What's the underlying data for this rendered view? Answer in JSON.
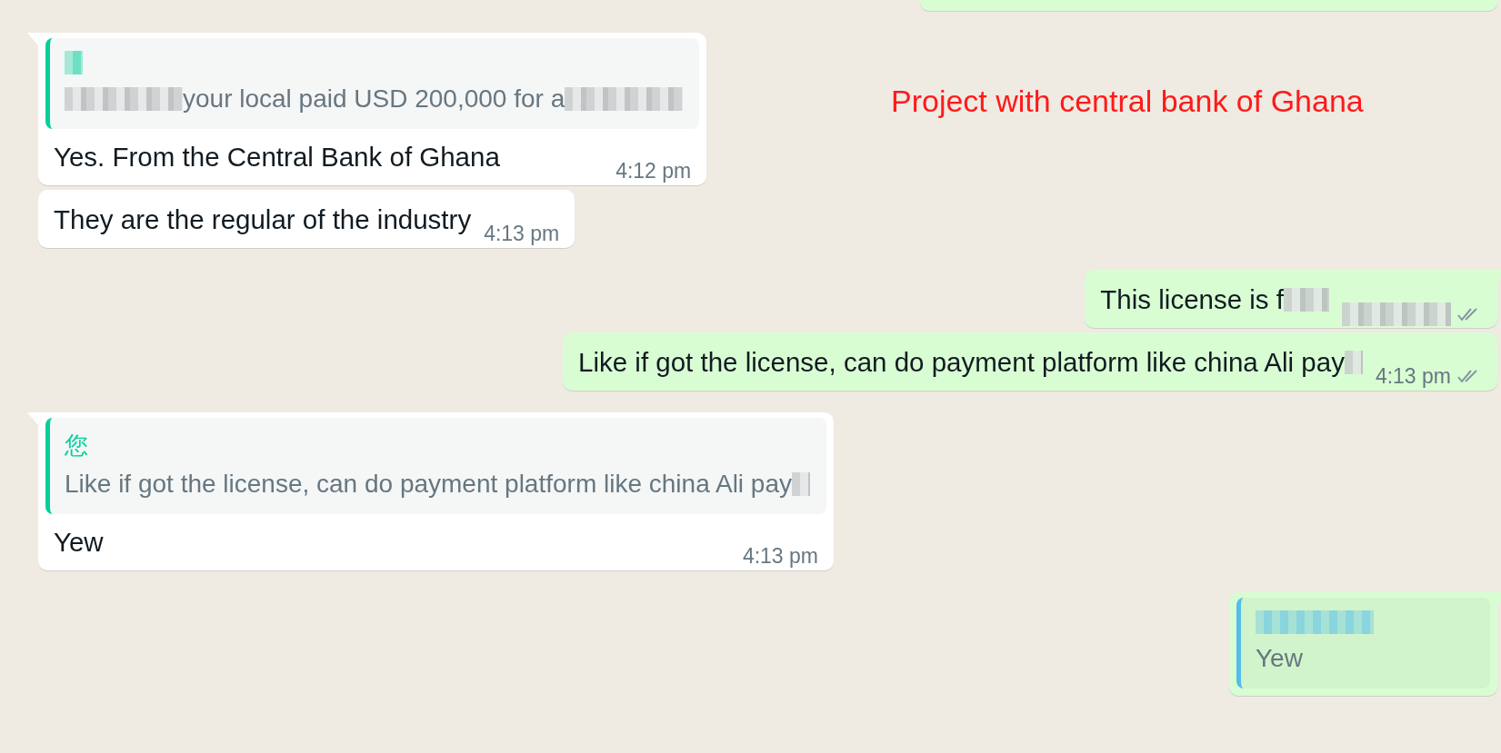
{
  "messages": [
    {
      "outgoing": true,
      "kind": "partial"
    },
    {
      "outgoing": false,
      "kind": "quoted",
      "quote": {
        "color": "#06cf9c",
        "author": [
          {
            "kind": "speck"
          }
        ],
        "text": [
          {
            "kind": "smear"
          },
          {
            "kind": "text",
            "text": "your local paid USD 200,000 for a"
          },
          {
            "kind": "smear"
          }
        ]
      },
      "text": [
        {
          "kind": "text",
          "text": "Yes. From the Central Bank of Ghana"
        }
      ],
      "time": "4:12 pm"
    },
    {
      "outgoing": false,
      "kind": "plain",
      "text": [
        {
          "kind": "text",
          "text": "They are the regular of the industry"
        }
      ],
      "time": "4:13 pm"
    },
    {
      "outgoing": true,
      "kind": "plain",
      "text": [
        {
          "kind": "text",
          "text": "This license is f"
        },
        {
          "kind": "patch"
        }
      ],
      "time_redacted": true,
      "delivered": true
    },
    {
      "outgoing": true,
      "kind": "plain",
      "text": [
        {
          "kind": "text",
          "text": "Like if got the license, can do payment platform like china Ali pay"
        },
        {
          "kind": "speck"
        }
      ],
      "time": "4:13 pm",
      "delivered": true
    },
    {
      "outgoing": false,
      "kind": "quoted",
      "quote": {
        "color": "#06cf9c",
        "author": [
          {
            "kind": "text",
            "text": "您"
          }
        ],
        "text": [
          {
            "kind": "text",
            "text": "Like if got the license, can do payment platform like china Ali pay"
          },
          {
            "kind": "speck"
          }
        ]
      },
      "text": [
        {
          "kind": "text",
          "text": "Yew"
        }
      ],
      "time": "4:13 pm"
    },
    {
      "outgoing": true,
      "kind": "quoted",
      "quote": {
        "color": "#53bdeb",
        "author": [
          {
            "kind": "smear"
          }
        ],
        "text": [
          {
            "kind": "text",
            "text": "Yew"
          }
        ]
      }
    }
  ],
  "annotation": "Project with central bank of Ghana"
}
